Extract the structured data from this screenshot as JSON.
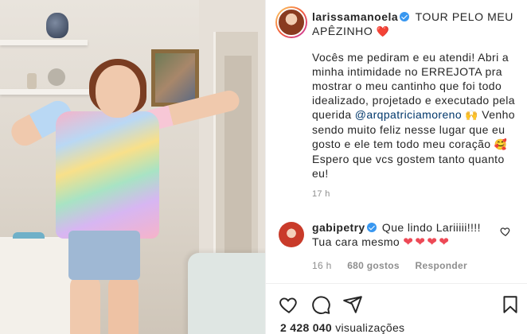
{
  "post": {
    "author": {
      "username": "larissamanoela",
      "verified": true,
      "avatar": "avatar-larissamanoela"
    },
    "caption": {
      "title": "TOUR PELO MEU APÊZINHO",
      "title_emoji": "❤️",
      "body_1": "Vocês me pediram e eu atendi! Abri a minha intimidade no ERREJOTA pra mostrar o meu cantinho que foi todo idealizado, projetado e executado pela querida ",
      "mention": "@arqpatriciamoreno",
      "mention_emoji": "🙌",
      "body_2": " Venho sendo muito feliz nesse lugar que eu gosto e ele tem todo meu coração ",
      "body_emoji": "🥰",
      "body_3": " Espero que vcs gostem tanto quanto eu!"
    },
    "time": "17 h"
  },
  "comments": [
    {
      "username": "gabipetry",
      "verified": true,
      "text": "Que lindo Lariiiii!!!! Tua cara mesmo",
      "hearts": [
        "❤",
        "❤",
        "❤",
        "❤"
      ],
      "time": "16 h",
      "likes": "680 gostos",
      "reply_label": "Responder"
    }
  ],
  "actions": {
    "like_icon": "heart-icon",
    "comment_icon": "comment-icon",
    "share_icon": "share-icon",
    "save_icon": "bookmark-icon"
  },
  "stats": {
    "views_count": "2 428 040",
    "views_label": "visualizações"
  },
  "colors": {
    "verified_blue": "#3897f0",
    "heart_red": "#ed4956",
    "mention_blue": "#00376b",
    "muted_gray": "#8e8e8e"
  }
}
